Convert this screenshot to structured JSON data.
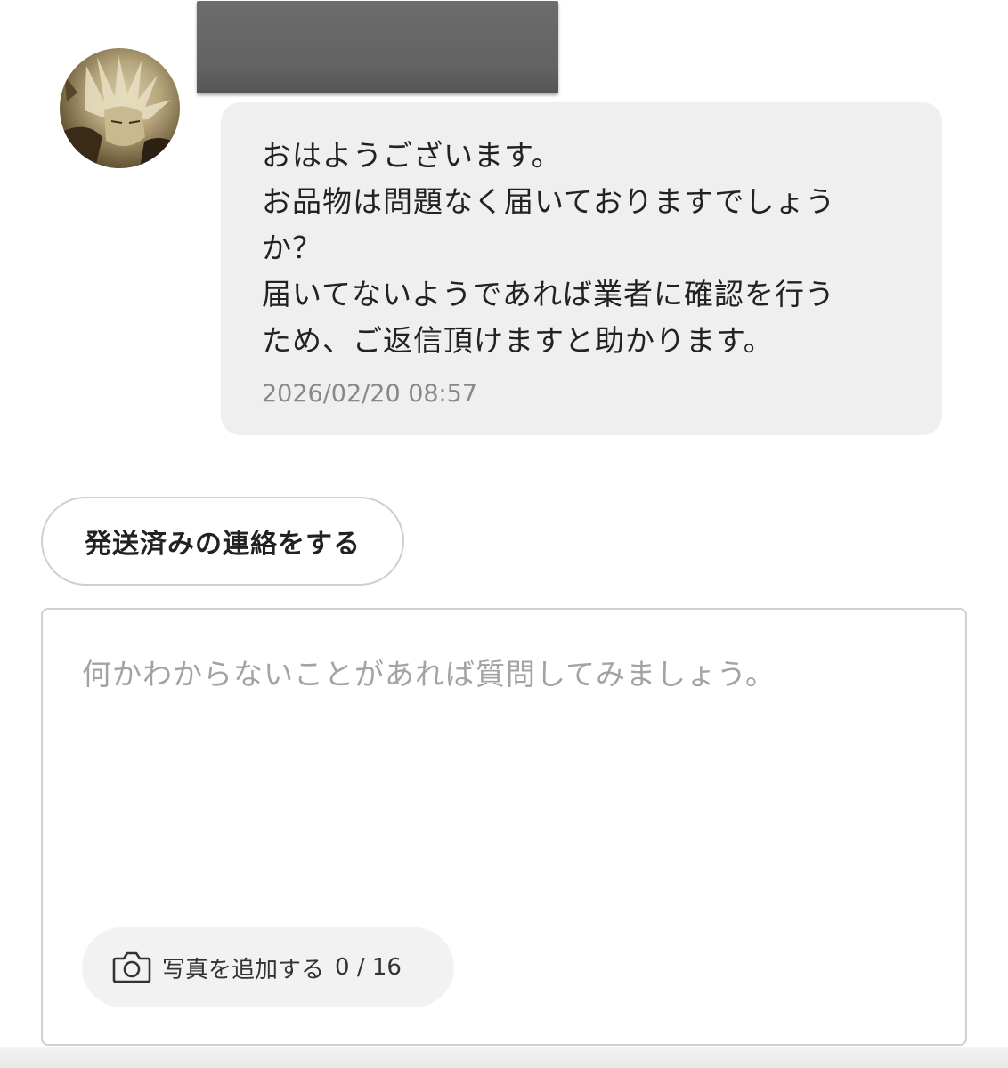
{
  "message": {
    "lines": [
      "おはようございます。",
      "お品物は問題なく届いておりますでしょう",
      "か？",
      "届いてないようであれば業者に確認を行う",
      "ため、ご返信頂けますと助かります。"
    ],
    "timestamp": "2026/02/20 08:57"
  },
  "actions": {
    "shipped_button_label": "発送済みの連絡をする"
  },
  "composer": {
    "placeholder": "何かわからないことがあれば質問してみましょう。",
    "add_photo_label": "写真を追加する",
    "photo_count": "0 / 16"
  },
  "icons": {
    "camera": "camera-icon"
  }
}
